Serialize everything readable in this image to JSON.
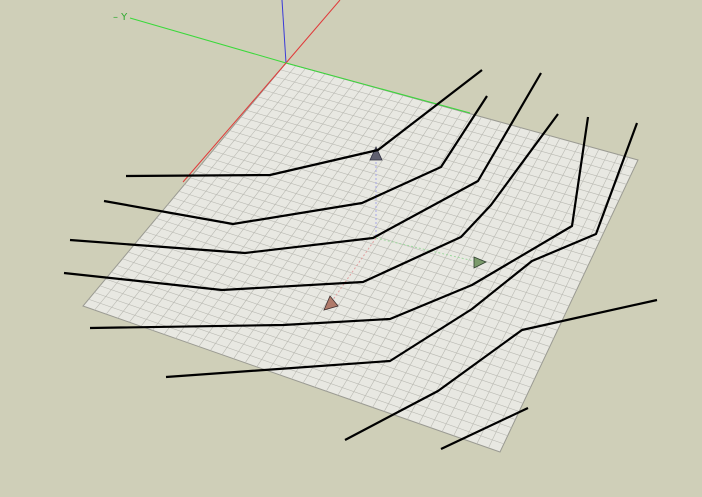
{
  "viewport": {
    "axis_label_green": "– Y",
    "colors": {
      "background": "#cfcfb8",
      "plane_fill": "#e8e8e2",
      "grid": "#b9b9b2",
      "axis_red": "#e03a3a",
      "axis_green": "#3ad93a",
      "axis_blue": "#3a3ad9",
      "contour": "#000000"
    },
    "icons": {
      "blue_marker": "axis-marker-cone-blue",
      "green_marker": "axis-marker-cone-green",
      "red_marker": "axis-marker-cone-red"
    }
  }
}
